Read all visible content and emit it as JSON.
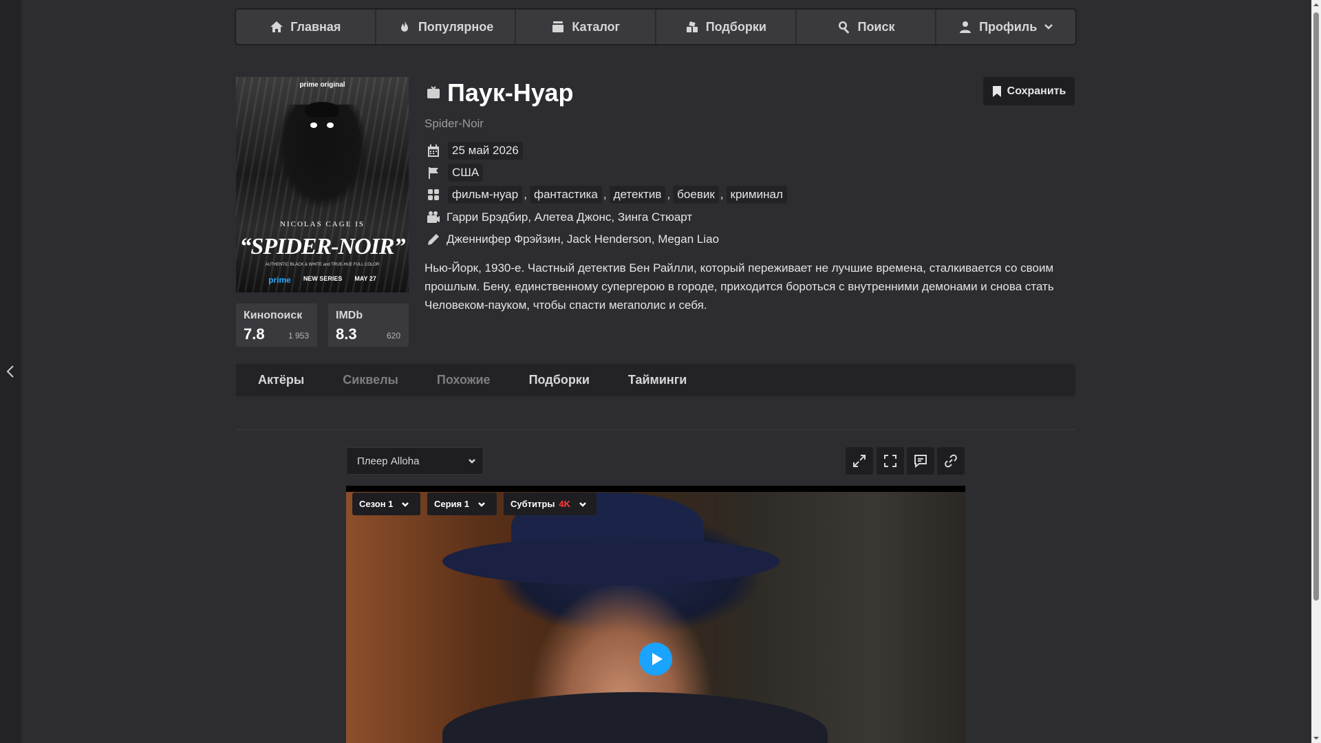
{
  "nav": {
    "items": [
      {
        "label": "Главная",
        "icon": "home-icon"
      },
      {
        "label": "Популярное",
        "icon": "fire-icon"
      },
      {
        "label": "Каталог",
        "icon": "catalog-icon"
      },
      {
        "label": "Подборки",
        "icon": "collections-icon"
      },
      {
        "label": "Поиск",
        "icon": "search-icon"
      },
      {
        "label": "Профиль",
        "icon": "user-icon"
      }
    ]
  },
  "poster": {
    "brand": "prime original",
    "actor_line": "NICOLAS CAGE IS",
    "logo": "“SPIDER-NOIR”",
    "tagline": "AUTHENTIC BLACK & WHITE and TRUE-HUE FULL COLOR",
    "prime": "prime",
    "series": "NEW SERIES",
    "date": "MAY 27"
  },
  "ratings": {
    "kinopoisk": {
      "name": "Кинопоиск",
      "score": "7.8",
      "votes": "1 953"
    },
    "imdb": {
      "name": "IMDb",
      "score": "8.3",
      "votes": "620"
    }
  },
  "movie": {
    "title": "Паук-Нуар",
    "original_title": "Spider-Noir",
    "date": "25 май 2026",
    "country": "США",
    "genres": [
      "фильм-нуар",
      "фантастика",
      "детектив",
      "боевик",
      "криминал"
    ],
    "directors": "Гарри Брэдбир, Алетеа Джонс, Зинга Стюарт",
    "writers": "Дженнифер Фрэйзин, Jack Henderson, Megan Liao",
    "description": "Нью-Йорк, 1930-е. Частный детектив Бен Райлли, который переживает не лучшие времена, сталкивается со своим прошлым. Бену, единственному супергерою в городе, приходится бороться с внутренними демонами и снова стать Человеком-пауком, чтобы спасти мегаполис и себя.",
    "save_label": "Сохранить"
  },
  "tabs": [
    "Актёры",
    "Сиквелы",
    "Похожие",
    "Подборки",
    "Тайминги"
  ],
  "player": {
    "selected": "Плеер Alloha",
    "season": "Сезон 1",
    "episode": "Серия 1",
    "subtitles": "Субтитры",
    "quality": "4K"
  },
  "colors": {
    "background": "#2d2c30",
    "panel": "#232226",
    "accent": "#1aa3ff",
    "quality_badge": "#ff3b3b"
  }
}
